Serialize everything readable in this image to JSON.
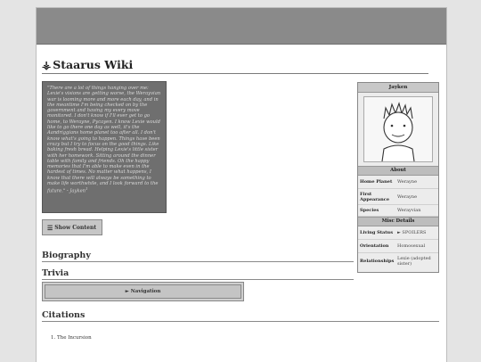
{
  "site": {
    "title": "Staarus Wiki",
    "logo_icon": "emblem-icon"
  },
  "quote": {
    "text": "\"There are a lot of things hanging over me: Lexie's visions are getting worse, the Werayvian war is looming more and more each day, and in the meantime I'm being checked on by the government and having my every move monitored. I don't know if I'll ever get to go home, to Werayne, Pycayen. I know Lexie would like to go there one day as well, it's the Aandriggians home planet too after all. I don't know what's going to happen. Things have been crazy but I try to focus on the good things. Like baking fresh bread. Helping Lexie's little sister with her homework. Sitting around the dinner table with family and friends. Oh the happy memories that I'm able to make even in the hardest of times. No matter what happens, I know that there will always be something to make life worthwhile, and I look forward to the future.\" - Jayken",
    "cite": "1"
  },
  "buttons": {
    "show_content": "Show Content",
    "show_icon": "list-icon"
  },
  "sections": {
    "biography": "Biography",
    "trivia": "Trivia",
    "citations": "Citations"
  },
  "navigation": {
    "label": "► Navigation"
  },
  "citations": [
    "1. The Incursion"
  ],
  "infobox": {
    "name": "Jayken",
    "about_header": "About",
    "about": [
      {
        "key": "Home Planet",
        "value": "Werayne"
      },
      {
        "key": "First Appearance",
        "value": "Werayne"
      },
      {
        "key": "Species",
        "value": "Werayvian"
      }
    ],
    "misc_header": "Misc Details",
    "misc": [
      {
        "key": "Living Status",
        "value": "► SPOILERS"
      },
      {
        "key": "Orientation",
        "value": "Homosexual"
      },
      {
        "key": "Relationships",
        "value": "Lexie (adopted sister)"
      }
    ]
  }
}
